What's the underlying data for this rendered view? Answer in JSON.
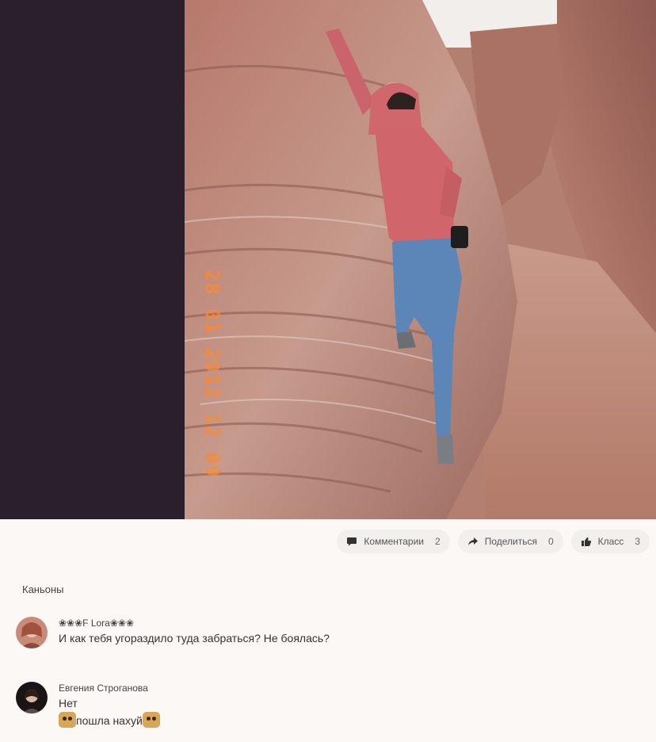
{
  "photo": {
    "date_stamp": "28 01 2012 12 09"
  },
  "actions": {
    "comments": {
      "label": "Комментарии",
      "count": "2",
      "icon": "comment-icon"
    },
    "share": {
      "label": "Поделиться",
      "count": "0",
      "icon": "share-icon"
    },
    "like": {
      "label": "Класс",
      "count": "3",
      "icon": "thumbs-up-icon"
    }
  },
  "album_title": "Каньоны",
  "comments": [
    {
      "author": "❀❀❀F Lora❀❀❀",
      "text": "И как тебя угораздило туда забраться? Не боялась?"
    },
    {
      "author": "Евгения Строганова",
      "lines": [
        "Нет",
        "пошла нахуй"
      ]
    }
  ],
  "colors": {
    "page_background": "#fbf8f6",
    "left_panel": "#2a1f2b",
    "action_pill": "#f3efec",
    "date_stamp": "#ff8a2a"
  }
}
